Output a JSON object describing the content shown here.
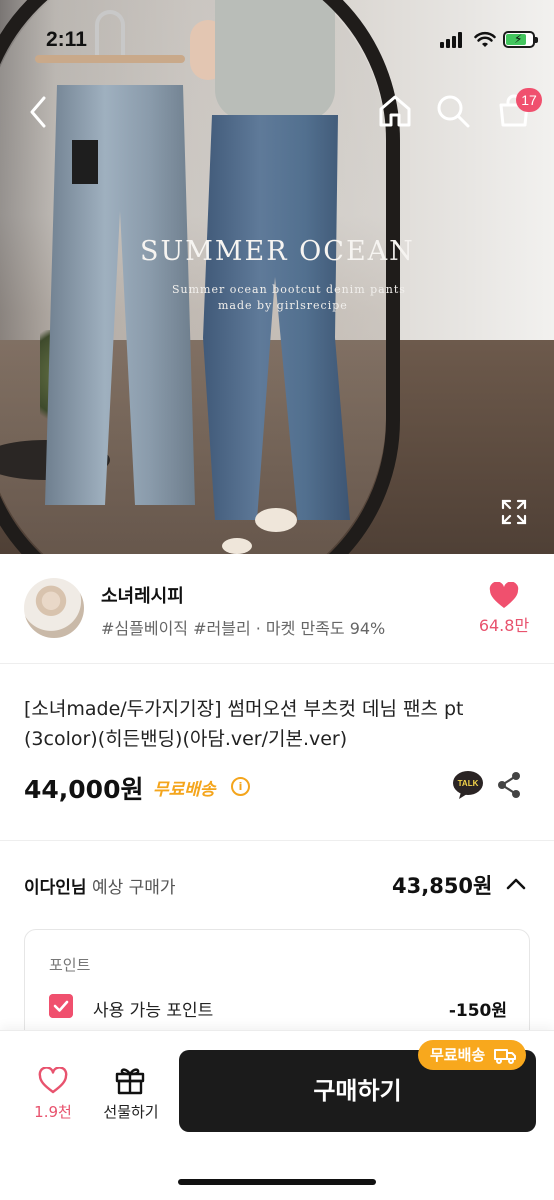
{
  "status_bar": {
    "time": "2:11"
  },
  "hero": {
    "title": "SUMMER OCEAN",
    "subtitle1": "Summer ocean bootcut denim pants",
    "subtitle2": "made by girlsrecipe"
  },
  "nav": {
    "cart_count": "17"
  },
  "seller": {
    "name": "소녀레시피",
    "tags": "#심플베이직 #러블리 · 마켓 만족도 94%",
    "likes": "64.8만"
  },
  "product": {
    "title": "[소녀made/두가지기장] 썸머오션 부츠컷 데님 팬츠 pt (3color)(히든밴딩)(아담.ver/기본.ver)",
    "price": "44,000원",
    "free_shipping": "무료배송"
  },
  "expected": {
    "user": "이다인님",
    "label": "예상 구매가",
    "price": "43,850원"
  },
  "points": {
    "title": "포인트",
    "label": "사용 가능 포인트",
    "value": "-150원"
  },
  "bottom": {
    "wish_count": "1.9천",
    "gift_label": "선물하기",
    "buy_label": "구매하기",
    "ship_badge": "무료배송"
  },
  "colors": {
    "accent_pink": "#f0506e",
    "shipping_orange": "#f4a51c",
    "buy_button": "#1b1b1b"
  },
  "icons": [
    "back-icon",
    "home-icon",
    "search-icon",
    "cart-icon",
    "expand-icon",
    "heart-filled-icon",
    "info-icon",
    "talk-icon",
    "share-icon",
    "chevron-up-icon",
    "checkbox-icon",
    "heart-outline-icon",
    "gift-icon",
    "truck-icon"
  ]
}
